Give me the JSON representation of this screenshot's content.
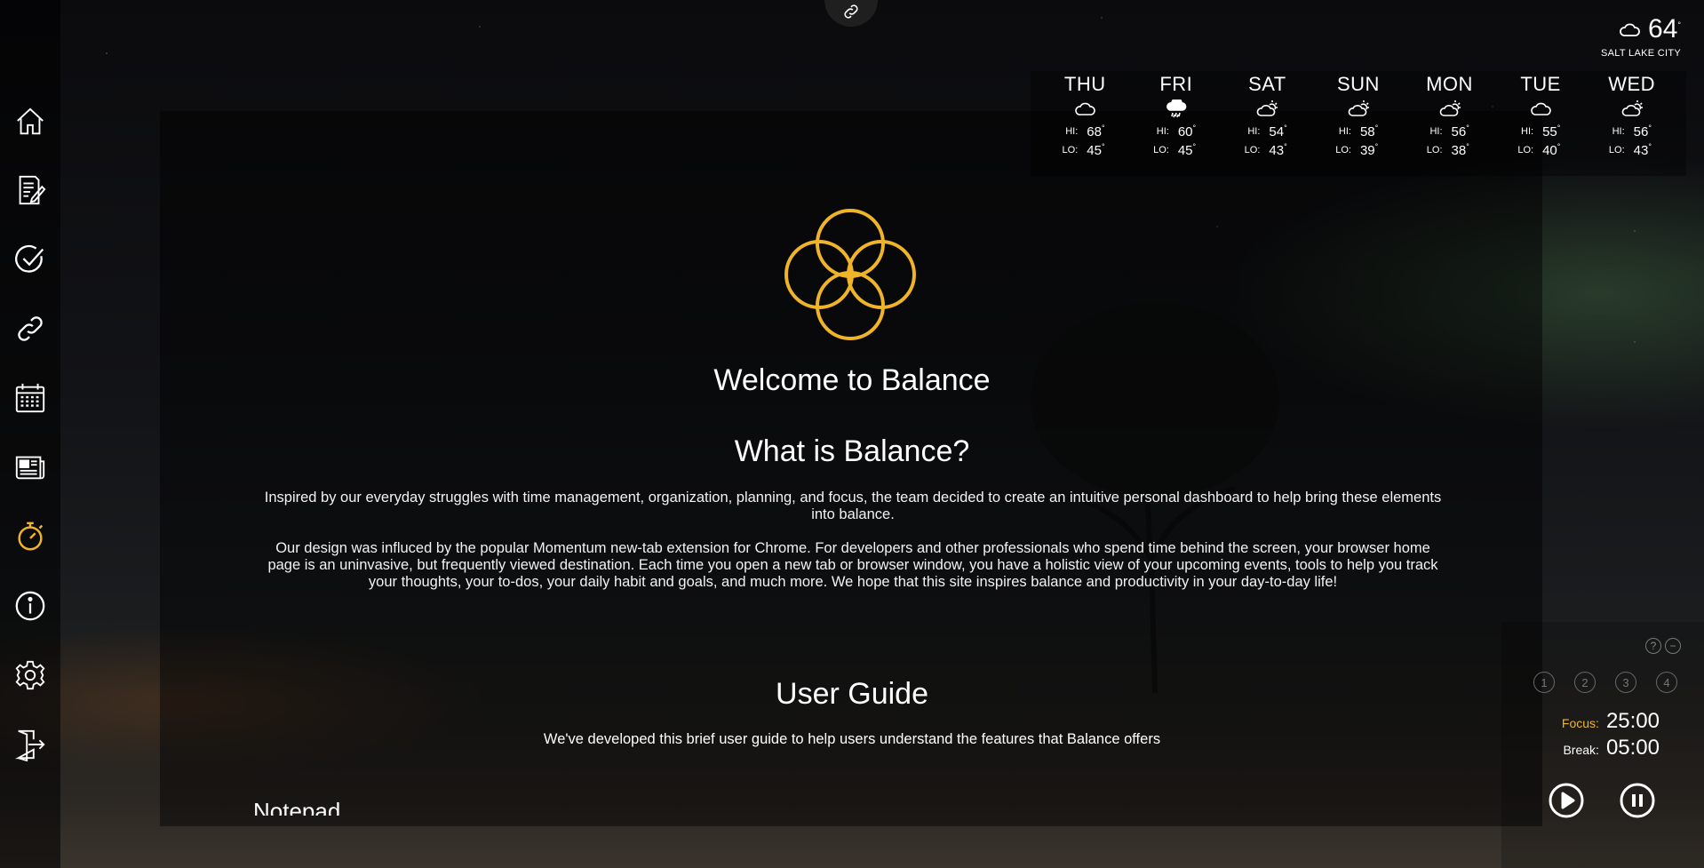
{
  "colors": {
    "accent": "#f0b429",
    "text": "#ffffff",
    "muted": "#888888"
  },
  "sidebar": {
    "items": [
      {
        "name": "home",
        "icon": "home-icon"
      },
      {
        "name": "notepad",
        "icon": "notepad-icon"
      },
      {
        "name": "todo",
        "icon": "check-circle-icon"
      },
      {
        "name": "links",
        "icon": "link-icon"
      },
      {
        "name": "calendar",
        "icon": "calendar-icon"
      },
      {
        "name": "news",
        "icon": "newspaper-icon"
      },
      {
        "name": "timer",
        "icon": "stopwatch-icon",
        "active": true
      },
      {
        "name": "about",
        "icon": "info-icon"
      },
      {
        "name": "settings",
        "icon": "gear-icon"
      },
      {
        "name": "logout",
        "icon": "logout-icon"
      }
    ]
  },
  "weather": {
    "current_temp": "64",
    "current_icon": "cloud-icon",
    "city": "SALT LAKE CITY",
    "hi_label": "HI:",
    "lo_label": "LO:",
    "forecast": [
      {
        "day": "THU",
        "icon": "cloud-icon",
        "hi": "68",
        "lo": "45"
      },
      {
        "day": "FRI",
        "icon": "rain-icon",
        "hi": "60",
        "lo": "45"
      },
      {
        "day": "SAT",
        "icon": "partly-cloudy-icon",
        "hi": "54",
        "lo": "43"
      },
      {
        "day": "SUN",
        "icon": "partly-cloudy-icon",
        "hi": "58",
        "lo": "39"
      },
      {
        "day": "MON",
        "icon": "partly-cloudy-icon",
        "hi": "56",
        "lo": "38"
      },
      {
        "day": "TUE",
        "icon": "cloud-icon",
        "hi": "55",
        "lo": "40"
      },
      {
        "day": "WED",
        "icon": "partly-cloudy-icon",
        "hi": "56",
        "lo": "43"
      }
    ]
  },
  "main": {
    "welcome": "Welcome to Balance",
    "what_title": "What is Balance?",
    "para1": "Inspired by our everyday struggles with time management, organization, planning, and focus, the team decided to create an intuitive personal dashboard to help bring these elements into balance.",
    "para2": "Our design was influced by the popular Momentum new-tab extension for Chrome. For developers and other professionals who spend time behind the screen, your browser home page is an uninvasive, but frequently viewed destination. Each time you open a new tab or browser window, you have a holistic view of your upcoming events, tools to help you track your thoughts, your to-dos, your daily habit and goals, and much more. We hope that this site inspires balance and productivity in your day-to-day life!",
    "guide_title": "User Guide",
    "guide_sub": "We've developed this brief user guide to help users understand the features that Balance offers",
    "notepad_heading": "Notepad"
  },
  "pomodoro": {
    "help": "?",
    "minimize": "−",
    "sessions": [
      "1",
      "2",
      "3",
      "4"
    ],
    "focus_label": "Focus:",
    "focus_time": "25:00",
    "break_label": "Break:",
    "break_time": "05:00"
  }
}
